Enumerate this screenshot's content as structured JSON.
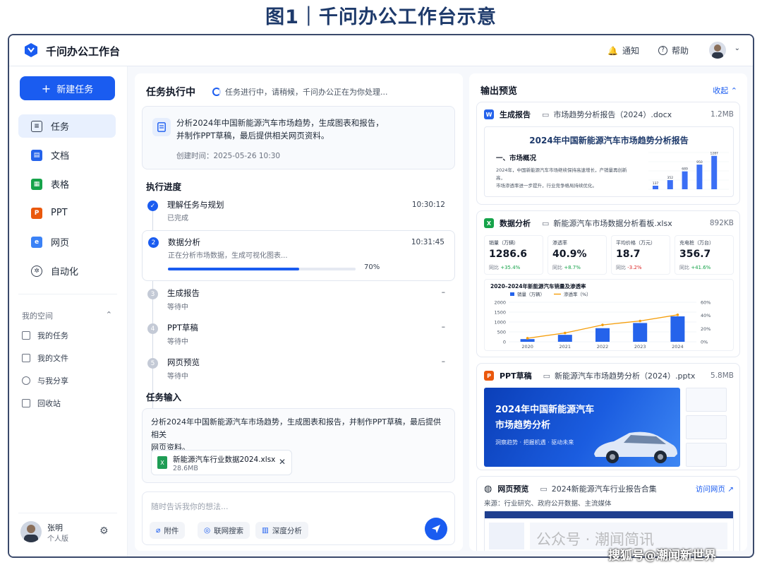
{
  "figure_title": "图1｜千问办公工作台示意",
  "app": {
    "title": "千问办公工作台"
  },
  "topbar": {
    "notify_label": "通知",
    "help_label": "帮助"
  },
  "sidebar": {
    "new_task_label": "新建任务",
    "nav": [
      {
        "label": "任务",
        "icon": "task-icon",
        "active": true
      },
      {
        "label": "文档",
        "icon": "doc-icon"
      },
      {
        "label": "表格",
        "icon": "sheet-icon"
      },
      {
        "label": "PPT",
        "icon": "ppt-icon"
      },
      {
        "label": "网页",
        "icon": "web-icon"
      },
      {
        "label": "自动化",
        "icon": "automation-icon"
      }
    ],
    "my_space_label": "我的空间",
    "space_items": [
      {
        "label": "我的任务",
        "icon": "file-icon"
      },
      {
        "label": "我的文件",
        "icon": "image-icon"
      },
      {
        "label": "与我分享",
        "icon": "share-icon"
      },
      {
        "label": "回收站",
        "icon": "trash-icon"
      }
    ],
    "user": {
      "name": "张明",
      "role": "个人版"
    }
  },
  "task": {
    "title": "任务执行中",
    "status": "任务进行中，请稍候，千问办公正在为你处理...",
    "description_line1": "分析2024年中国新能源汽车市场趋势，生成图表和报告，",
    "description_line2": "并制作PPT草稿，最后提供相关网页资料。",
    "created": "创建时间：2025-05-26 10:30",
    "progress_title": "执行进度",
    "steps": [
      {
        "num": "1",
        "name": "理解任务与规划",
        "sub": "已完成",
        "time": "10:30:12",
        "state": "done"
      },
      {
        "num": "2",
        "name": "数据分析",
        "sub": "正在分析市场数据，生成可视化图表...",
        "time": "10:31:45",
        "state": "active",
        "progress": 70,
        "progress_label": "70%"
      },
      {
        "num": "3",
        "name": "生成报告",
        "sub": "等待中",
        "time": "–",
        "state": "pending"
      },
      {
        "num": "4",
        "name": "PPT草稿",
        "sub": "等待中",
        "time": "–",
        "state": "pending"
      },
      {
        "num": "5",
        "name": "网页预览",
        "sub": "等待中",
        "time": "–",
        "state": "pending"
      }
    ],
    "input_title": "任务输入",
    "input_text_line1": "分析2024年中国新能源汽车市场趋势，生成图表和报告，并制作PPT草稿，最后提供相关",
    "input_text_line2": "网页资料。",
    "attachment": {
      "name": "新能源汽车行业数据2024.xlsx",
      "size": "28.6MB"
    },
    "compose_placeholder": "随时告诉我你的想法...",
    "compose_buttons": [
      "附件",
      "联网搜索",
      "深度分析"
    ]
  },
  "output": {
    "title": "输出预览",
    "collapse_label": "收起",
    "report": {
      "type": "生成报告",
      "file": "市场趋势分析报告（2024）.docx",
      "size": "1.2MB",
      "doc_title": "2024年中国新能源汽车市场趋势分析报告",
      "section": "一、市场概况",
      "para_line1": "2024年，中国新能源汽车市场继续保持高速增长，产销量再创新高，",
      "para_line2": "市场渗透率进一步提升，行业竞争格局持续优化。"
    },
    "analysis": {
      "type": "数据分析",
      "file": "新能源汽车市场数据分析看板.xlsx",
      "size": "892KB",
      "kpis": [
        {
          "label": "销量（万辆）",
          "value": "1286.6",
          "delta_prefix": "同比",
          "delta": "+35.4%",
          "dir": "up"
        },
        {
          "label": "渗透率",
          "value": "40.9%",
          "delta_prefix": "同比",
          "delta": "+8.7%",
          "dir": "up"
        },
        {
          "label": "平均价格（万元）",
          "value": "18.7",
          "delta_prefix": "同比",
          "delta": "-3.2%",
          "dir": "dn"
        },
        {
          "label": "充电桩（万台）",
          "value": "356.7",
          "delta_prefix": "同比",
          "delta": "+41.6%",
          "dir": "up"
        }
      ]
    },
    "ppt": {
      "type": "PPT草稿",
      "file": "新能源汽车市场趋势分析（2024）.pptx",
      "size": "5.8MB",
      "hero_line1": "2024年中国新能源汽车",
      "hero_line2": "市场趋势分析",
      "hero_sub": "洞察趋势 · 把握机遇 · 驱动未来"
    },
    "web": {
      "type": "网页预览",
      "file": "2024新能源汽车行业报告合集",
      "visit_label": "访问网页",
      "source": "来源：行业研究、政府公开数据、主流媒体"
    }
  },
  "chart_data": [
    {
      "type": "bar",
      "title": "2020–2024年新能源汽车销量及渗透率",
      "categories": [
        "2020",
        "2021",
        "2022",
        "2023",
        "2024"
      ],
      "series": [
        {
          "name": "销量（万辆）",
          "type": "bar",
          "values": [
            136.7,
            352.1,
            688.7,
            949.5,
            1286.6
          ]
        },
        {
          "name": "渗透率（%）",
          "type": "line",
          "values": [
            5.4,
            13.4,
            25.6,
            31.6,
            40.9
          ]
        }
      ],
      "ylim": [
        0,
        2000
      ],
      "y2lim": [
        0,
        60
      ],
      "yticks": [
        "0",
        "500",
        "1000",
        "1500",
        "2000"
      ],
      "y2ticks": [
        "0%",
        "20%",
        "40%",
        "60%"
      ]
    },
    {
      "type": "bar",
      "categories": [
        "2020",
        "2021",
        "2022",
        "2023",
        "2024"
      ],
      "values": [
        136.7,
        352.1,
        688.7,
        949.5,
        1286.6
      ],
      "data_labels": [
        "137",
        "352",
        "689",
        "950",
        "1287"
      ]
    }
  ],
  "watermark": {
    "line1": "公众号 · 潮闻简讯",
    "line2": "搜狐号@潮闻新世界"
  }
}
